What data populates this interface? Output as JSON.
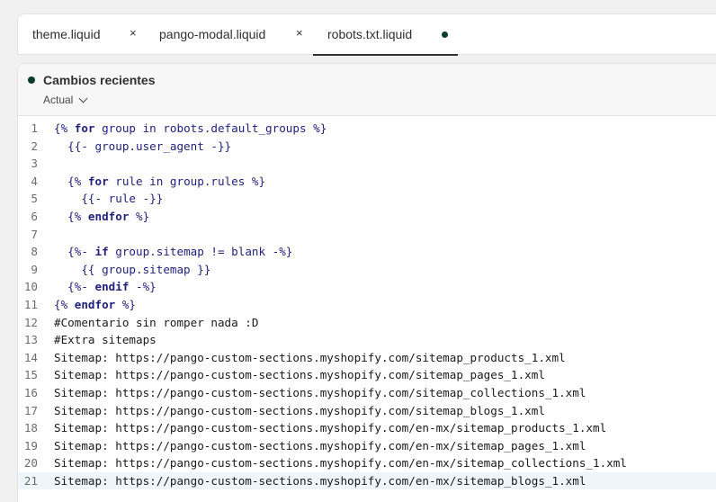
{
  "tabs": [
    {
      "label": "theme.liquid",
      "close": "×"
    },
    {
      "label": "pango-modal.liquid",
      "close": "×"
    },
    {
      "label": "robots.txt.liquid",
      "close": ""
    }
  ],
  "changes": {
    "title": "Cambios recientes",
    "version": "Actual"
  },
  "code": [
    {
      "n": "1",
      "t": "{% for group in robots.default_groups %}"
    },
    {
      "n": "2",
      "t": "  {{- group.user_agent -}}"
    },
    {
      "n": "3",
      "t": ""
    },
    {
      "n": "4",
      "t": "  {% for rule in group.rules %}"
    },
    {
      "n": "5",
      "t": "    {{- rule -}}"
    },
    {
      "n": "6",
      "t": "  {% endfor %}"
    },
    {
      "n": "7",
      "t": ""
    },
    {
      "n": "8",
      "t": "  {%- if group.sitemap != blank -%}"
    },
    {
      "n": "9",
      "t": "    {{ group.sitemap }}"
    },
    {
      "n": "10",
      "t": "  {%- endif -%}"
    },
    {
      "n": "11",
      "t": "{% endfor %}"
    },
    {
      "n": "12",
      "t": "#Comentario sin romper nada :D"
    },
    {
      "n": "13",
      "t": "#Extra sitemaps"
    },
    {
      "n": "14",
      "t": "Sitemap: https://pango-custom-sections.myshopify.com/sitemap_products_1.xml"
    },
    {
      "n": "15",
      "t": "Sitemap: https://pango-custom-sections.myshopify.com/sitemap_pages_1.xml"
    },
    {
      "n": "16",
      "t": "Sitemap: https://pango-custom-sections.myshopify.com/sitemap_collections_1.xml"
    },
    {
      "n": "17",
      "t": "Sitemap: https://pango-custom-sections.myshopify.com/sitemap_blogs_1.xml"
    },
    {
      "n": "18",
      "t": "Sitemap: https://pango-custom-sections.myshopify.com/en-mx/sitemap_products_1.xml"
    },
    {
      "n": "19",
      "t": "Sitemap: https://pango-custom-sections.myshopify.com/en-mx/sitemap_pages_1.xml"
    },
    {
      "n": "20",
      "t": "Sitemap: https://pango-custom-sections.myshopify.com/en-mx/sitemap_collections_1.xml"
    },
    {
      "n": "21",
      "t": "Sitemap: https://pango-custom-sections.myshopify.com/en-mx/sitemap_blogs_1.xml"
    }
  ]
}
